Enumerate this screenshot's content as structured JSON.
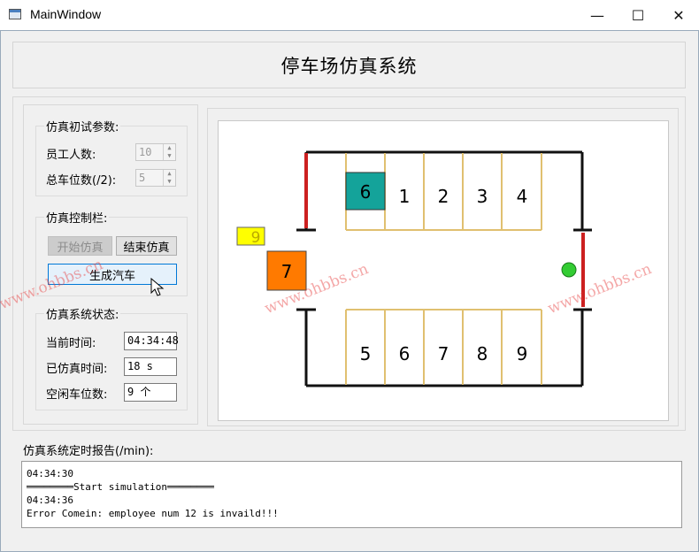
{
  "window": {
    "title": "MainWindow",
    "minimize_glyph": "—",
    "maximize_glyph": "☐",
    "close_glyph": "✕",
    "icon": "app-window-icon"
  },
  "header": {
    "title": "停车场仿真系统"
  },
  "params": {
    "title": "仿真初试参数:",
    "staff_label": "员工人数:",
    "staff_value": "10",
    "slots_label": "总车位数(/2):",
    "slots_value": "5"
  },
  "control": {
    "title": "仿真控制栏:",
    "start_label": "开始仿真",
    "stop_label": "结束仿真",
    "generate_label": "生成汽车"
  },
  "status": {
    "title": "仿真系统状态:",
    "current_time_label": "当前时间:",
    "current_time_value": "04:34:48",
    "elapsed_label": "已仿真时间:",
    "elapsed_value": "18 s",
    "free_label": "空闲车位数:",
    "free_value": "9 个"
  },
  "lot": {
    "top_slots": [
      "1",
      "2",
      "3",
      "4"
    ],
    "bottom_slots": [
      "5",
      "6",
      "7",
      "8",
      "9"
    ],
    "parked_car": "6",
    "entering_car": "7",
    "queued_car": "9",
    "colors": {
      "wall": "#111111",
      "slot_line": "#e0c070",
      "gate": "#cc2020",
      "parked_car": "#14a39a",
      "entering_car": "#ff7a00",
      "queued_car": "#ffff00",
      "exit_light": "#33cc33"
    }
  },
  "report": {
    "title": "仿真系统定时报告(/min):",
    "lines": [
      "04:34:30",
      "════════Start simulation════════",
      "04:34:36",
      "Error Comein: employee num 12 is invaild!!!"
    ]
  },
  "watermark": {
    "text": "www.ohbbs.cn"
  }
}
